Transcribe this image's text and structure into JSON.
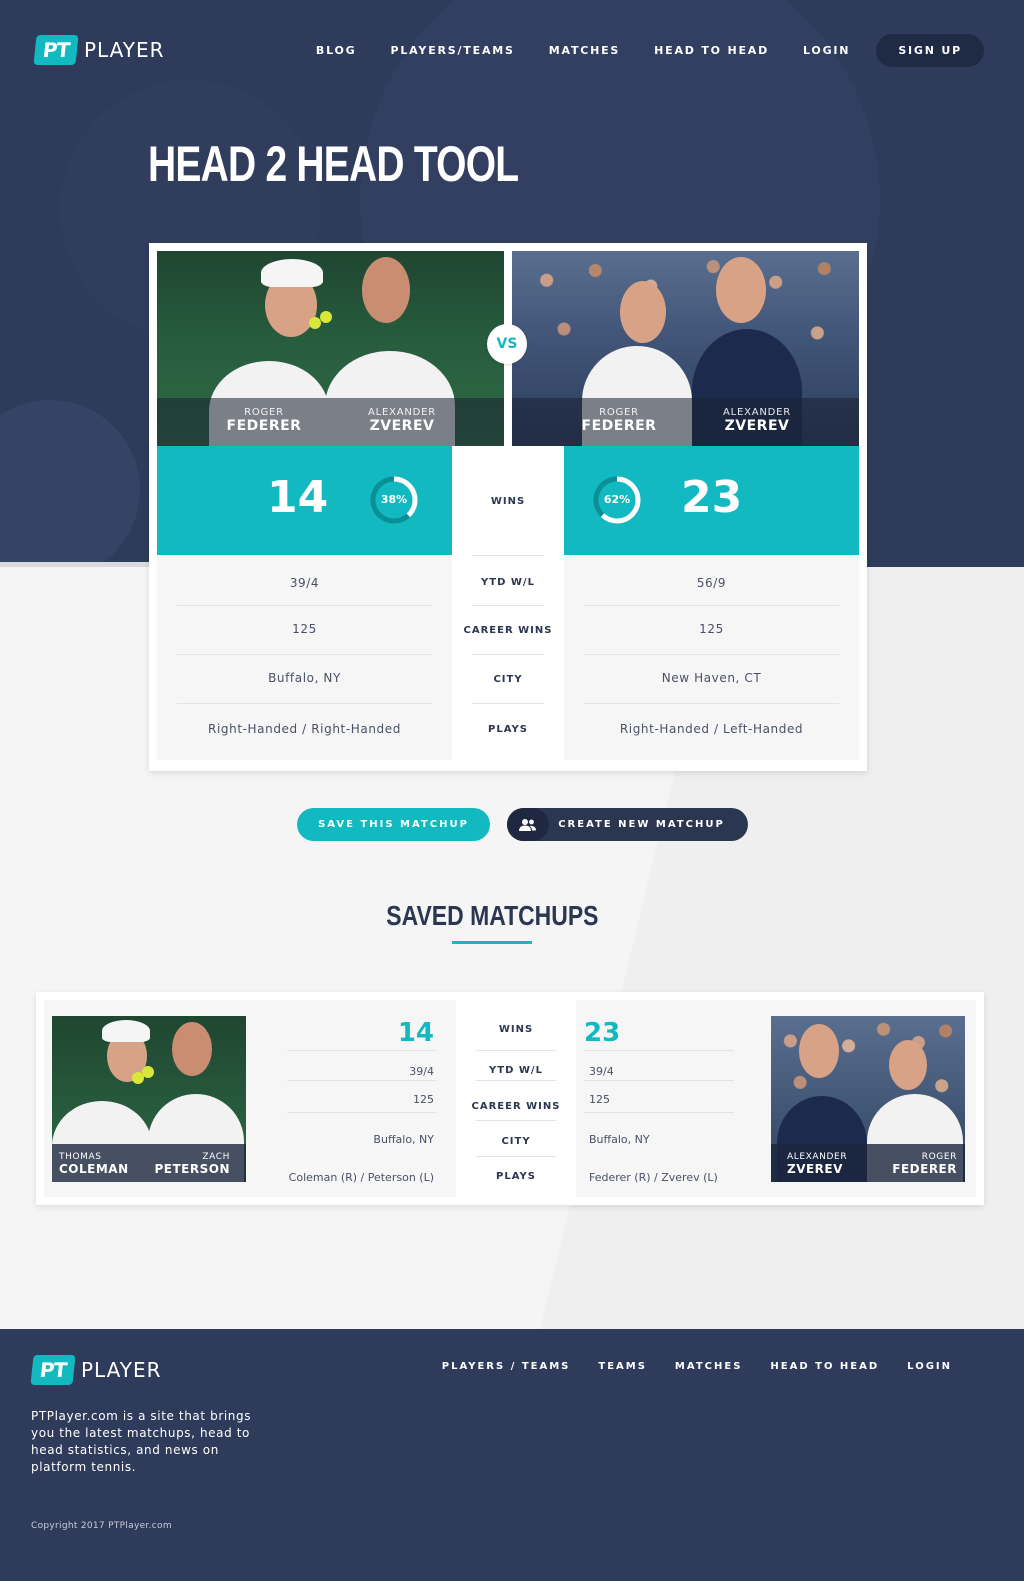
{
  "brand": {
    "logo_badge": "PT",
    "logo_text": "PLAYER",
    "accent": "#12b9c1",
    "navy": "#2e3b5b"
  },
  "nav": {
    "items": [
      "BLOG",
      "PLAYERS/TEAMS",
      "MATCHES",
      "HEAD TO HEAD",
      "LOGIN"
    ],
    "signup": "SIGN UP"
  },
  "hero": {
    "title": "HEAD 2 HEAD TOOL"
  },
  "compare": {
    "vs": "VS",
    "left": {
      "players": [
        {
          "first": "ROGER",
          "last": "FEDERER"
        },
        {
          "first": "ALEXANDER",
          "last": "ZVEREV"
        }
      ],
      "wins": "14",
      "percent_label": "38%",
      "percent": 0.38,
      "ytd": "39/4",
      "career_wins": "125",
      "city": "Buffalo, NY",
      "plays": "Right-Handed / Right-Handed"
    },
    "right": {
      "players": [
        {
          "first": "ROGER",
          "last": "FEDERER"
        },
        {
          "first": "ALEXANDER",
          "last": "ZVEREV"
        }
      ],
      "wins": "23",
      "percent_label": "62%",
      "percent": 0.62,
      "ytd": "56/9",
      "career_wins": "125",
      "city": "New Haven, CT",
      "plays": "Right-Handed / Left-Handed"
    },
    "labels": {
      "wins": "WINS",
      "ytd": "YTD W/L",
      "career": "CAREER WINS",
      "city": "CITY",
      "plays": "PLAYS"
    }
  },
  "actions": {
    "save": "SAVE THIS MATCHUP",
    "create": "CREATE NEW MATCHUP"
  },
  "saved": {
    "title": "SAVED MATCHUPS",
    "labels": {
      "wins": "WINS",
      "ytd": "YTD W/L",
      "career": "CAREER WINS",
      "city": "CITY",
      "plays": "PLAYS"
    },
    "left": {
      "players": [
        {
          "first": "THOMAS",
          "last": "COLEMAN"
        },
        {
          "first": "ZACH",
          "last": "PETERSON"
        }
      ],
      "wins": "14",
      "ytd": "39/4",
      "career_wins": "125",
      "city": "Buffalo, NY",
      "plays": "Coleman (R) / Peterson (L)"
    },
    "right": {
      "players": [
        {
          "first": "ALEXANDER",
          "last": "ZVEREV"
        },
        {
          "first": "ROGER",
          "last": "FEDERER"
        }
      ],
      "wins": "23",
      "ytd": "39/4",
      "career_wins": "125",
      "city": "Buffalo, NY",
      "plays": "Federer (R) / Zverev (L)"
    }
  },
  "footer": {
    "logo_badge": "PT",
    "logo_text": "PLAYER",
    "links": [
      "PLAYERS / TEAMS",
      "TEAMS",
      "MATCHES",
      "HEAD TO HEAD",
      "LOGIN"
    ],
    "about": "PTPlayer.com is a site that brings you the latest matchups, head to head statistics, and news on platform tennis.",
    "copyright": "Copyright 2017 PTPlayer.com"
  }
}
